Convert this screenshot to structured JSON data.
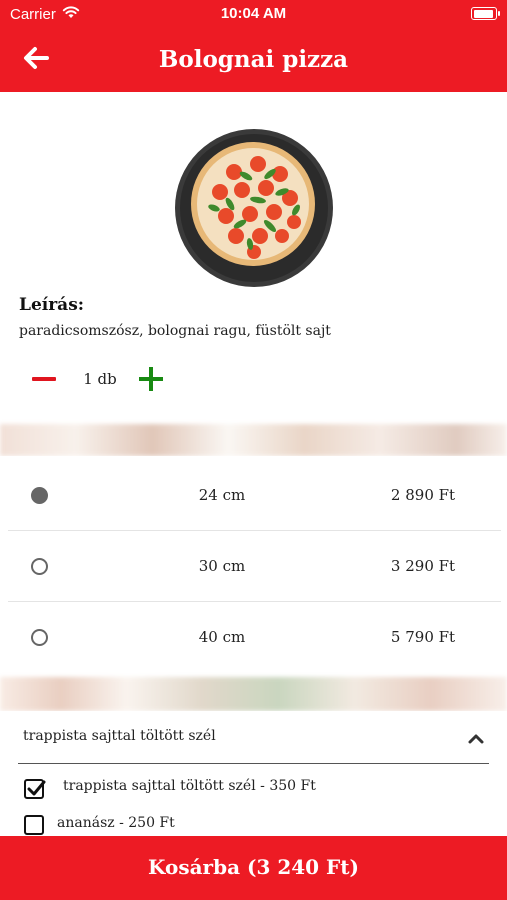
{
  "status_bar": {
    "carrier": "Carrier",
    "time": "10:04 AM",
    "wifi_icon": "wifi-icon",
    "battery_icon": "battery-icon"
  },
  "header": {
    "title": "Bolognai pizza",
    "back_icon": "arrow-left-icon"
  },
  "product": {
    "image_icon": "pizza-image",
    "description_title": "Leírás:",
    "description": "paradicsomszósz, bolognai ragu, füstölt sajt"
  },
  "quantity": {
    "value": "1 db",
    "minus_icon": "minus-icon",
    "plus_icon": "plus-icon"
  },
  "sizes": [
    {
      "label": "24 cm",
      "price": "2 890 Ft",
      "selected": true
    },
    {
      "label": "30 cm",
      "price": "3 290 Ft",
      "selected": false
    },
    {
      "label": "40 cm",
      "price": "5 790 Ft",
      "selected": false
    }
  ],
  "extras": {
    "title": "trappista sajttal töltött szél",
    "expanded_icon": "chevron-up-icon",
    "options": [
      {
        "label": "trappista sajttal töltött szél - 350 Ft",
        "checked": true
      },
      {
        "label": "ananász - 250 Ft",
        "checked": false
      }
    ]
  },
  "cart": {
    "label": "Kosárba (3 240 Ft)"
  },
  "colors": {
    "brand_red": "#ed1b24",
    "minus_red": "#e0151f",
    "plus_green": "#188a12"
  }
}
